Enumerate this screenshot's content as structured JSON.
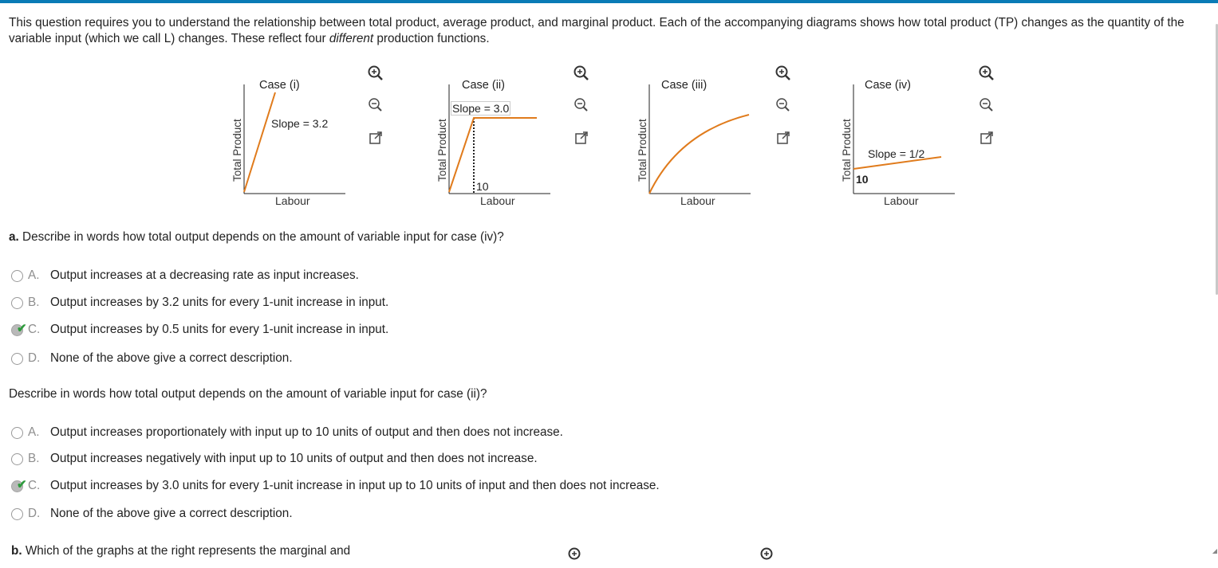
{
  "intro": {
    "part1": "This question requires you to understand the relationship between total product, average product, and marginal product. Each of the accompanying diagrams shows how total product (TP) changes as the quantity of the variable input (which we call L) changes. These reflect four ",
    "emph": "different",
    "part2": " production functions."
  },
  "colors": {
    "curve": "#e07b1c",
    "axis": "#222222",
    "accent": "#0a7bb6",
    "check": "#2d9a3c"
  },
  "graphs": [
    {
      "title": "Case (i)",
      "ylabel": "Total Product",
      "xlabel": "Labour",
      "slope_label": "Slope = 3.2"
    },
    {
      "title": "Case (ii)",
      "ylabel": "Total Product",
      "xlabel": "Labour",
      "slope_label": "Slope = 3.0",
      "tick": "10"
    },
    {
      "title": "Case (iii)",
      "ylabel": "Total Product",
      "xlabel": "Labour"
    },
    {
      "title": "Case (iv)",
      "ylabel": "Total Product",
      "xlabel": "Labour",
      "slope_label": "Slope = 1/2",
      "tick": "10"
    }
  ],
  "tools": [
    "zoom-in-icon",
    "zoom-out-icon",
    "popout-icon"
  ],
  "part_a": {
    "label": "a.",
    "question": " Describe in words how total output depends on the amount of variable input for case (iv)?",
    "selected": "C",
    "options": [
      {
        "letter": "A.",
        "text": "Output increases at a decreasing rate as input increases."
      },
      {
        "letter": "B.",
        "text": "Output increases by 3.2 units for every 1-unit increase in input."
      },
      {
        "letter": "C.",
        "text": "Output increases by 0.5 units for every 1-unit increase in input."
      },
      {
        "letter": "D.",
        "text": "None of the above give a correct description."
      }
    ]
  },
  "part_a2": {
    "question": "Describe in words how total output depends on the amount of variable input for case (ii)?",
    "selected": "C",
    "options": [
      {
        "letter": "A.",
        "text": "Output increases proportionately with input up to 10 units of output and then does not increase."
      },
      {
        "letter": "B.",
        "text": "Output increases negatively with input up to 10 units of output and then does not increase."
      },
      {
        "letter": "C.",
        "text": "Output increases by 3.0 units for every 1-unit increase in input up to 10 units of input and then does not increase."
      },
      {
        "letter": "D.",
        "text": "None of the above give a correct description."
      }
    ]
  },
  "part_b": {
    "label": "b.",
    "question": " Which of the graphs at the right represents the marginal and"
  }
}
